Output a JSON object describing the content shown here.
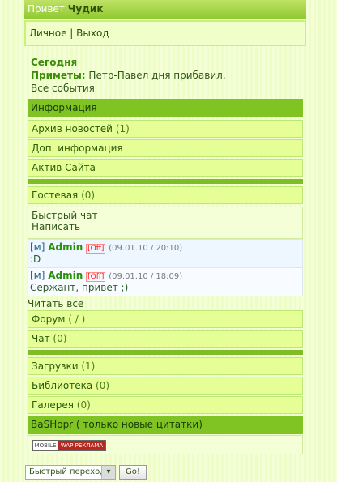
{
  "header": {
    "greeting": "Привет",
    "user": "Чудик"
  },
  "user_menu": {
    "personal": "Личное",
    "separator": " | ",
    "logout": "Выход"
  },
  "today": {
    "title": "Сегодня",
    "omens_label": "Приметы:",
    "omens_text": "Петр-Павел дня прибавил.",
    "all_events": "Все события"
  },
  "sections": {
    "info": "Информация",
    "archive": "Архив новостей",
    "archive_count": "(1)",
    "extra_info": "Доп. информация",
    "active_site": "Актив Сайта",
    "guestbook": "Гостевая",
    "guestbook_count": "(0)",
    "quick_chat": "Быстрый чат",
    "write": "Написать",
    "read_all": "Читать все",
    "forum": "Форум",
    "forum_count": "( / )",
    "chat": "Чат",
    "chat_count": "(0)",
    "downloads": "Загрузки",
    "downloads_count": "(1)",
    "library": "Библиотека",
    "library_count": "(0)",
    "gallery": "Галерея",
    "gallery_count": "(0)",
    "bashorg": "BaSHopr ( только новые цитатки)"
  },
  "messages": [
    {
      "tag": "[м]",
      "author": "Admin",
      "status": "[Off]",
      "date": "(09.01.10 / 20:10)",
      "text": ":D"
    },
    {
      "tag": "[м]",
      "author": "Admin",
      "status": "[Off]",
      "date": "(09.01.10 / 18:09)",
      "text": "Сержант, привет ;)"
    }
  ],
  "ad": {
    "mobile": "MOBILE",
    "wap": "WAP РЕКЛАМА"
  },
  "footer": {
    "quick_nav": "Быстрый переход",
    "go": "Go!"
  }
}
